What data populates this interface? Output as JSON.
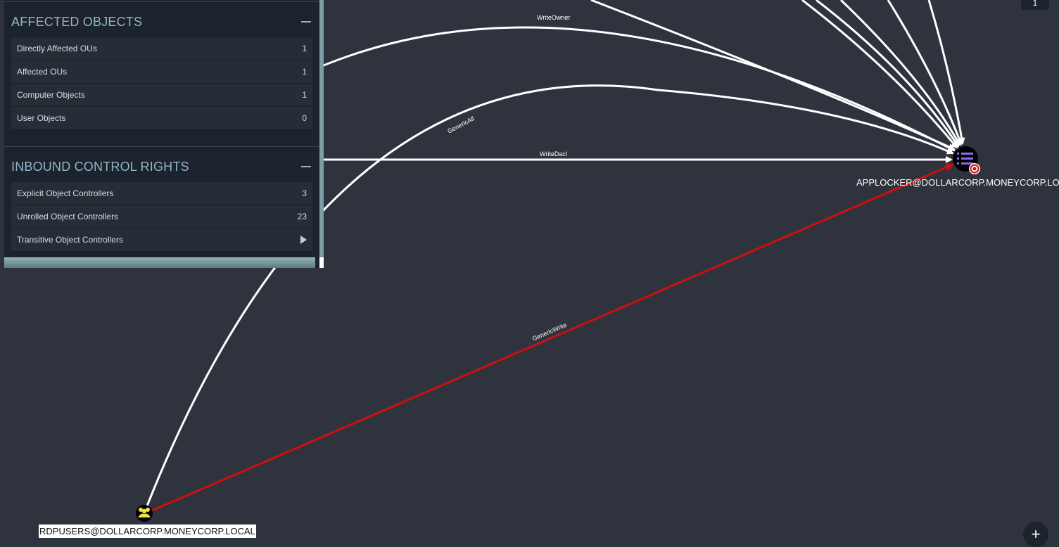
{
  "panel": {
    "affected": {
      "title": "AFFECTED OBJECTS",
      "rows": [
        {
          "label": "Directly Affected OUs",
          "value": "1"
        },
        {
          "label": "Affected OUs",
          "value": "1"
        },
        {
          "label": "Computer Objects",
          "value": "1"
        },
        {
          "label": "User Objects",
          "value": "0"
        }
      ]
    },
    "inbound": {
      "title": "INBOUND CONTROL RIGHTS",
      "rows": [
        {
          "label": "Explicit Object Controllers",
          "value": "3"
        },
        {
          "label": "Unrolled Object Controllers",
          "value": "23"
        },
        {
          "label": "Transitive Object Controllers",
          "value": ""
        }
      ]
    }
  },
  "graph": {
    "edges": {
      "write_owner": "WriteOwner",
      "generic_all": "GenericAll",
      "write_dacl": "WriteDacl",
      "generic_write": "GenericWrite"
    },
    "nodes": {
      "target": {
        "label": "APPLOCKER@DOLLARCORP.MONEYCORP.LOCAL",
        "icon": "gpo-list-icon"
      },
      "source": {
        "label": "RDPUSERS@DOLLARCORP.MONEYCORP.LOCAL",
        "icon": "group-icon"
      }
    },
    "colors": {
      "background": "#2f333d",
      "edge": "#ffffff",
      "highlight_edge": "#cc1010",
      "source_node": "#f0e040"
    }
  },
  "controls": {
    "top_right": "1",
    "zoom_in": "+"
  }
}
